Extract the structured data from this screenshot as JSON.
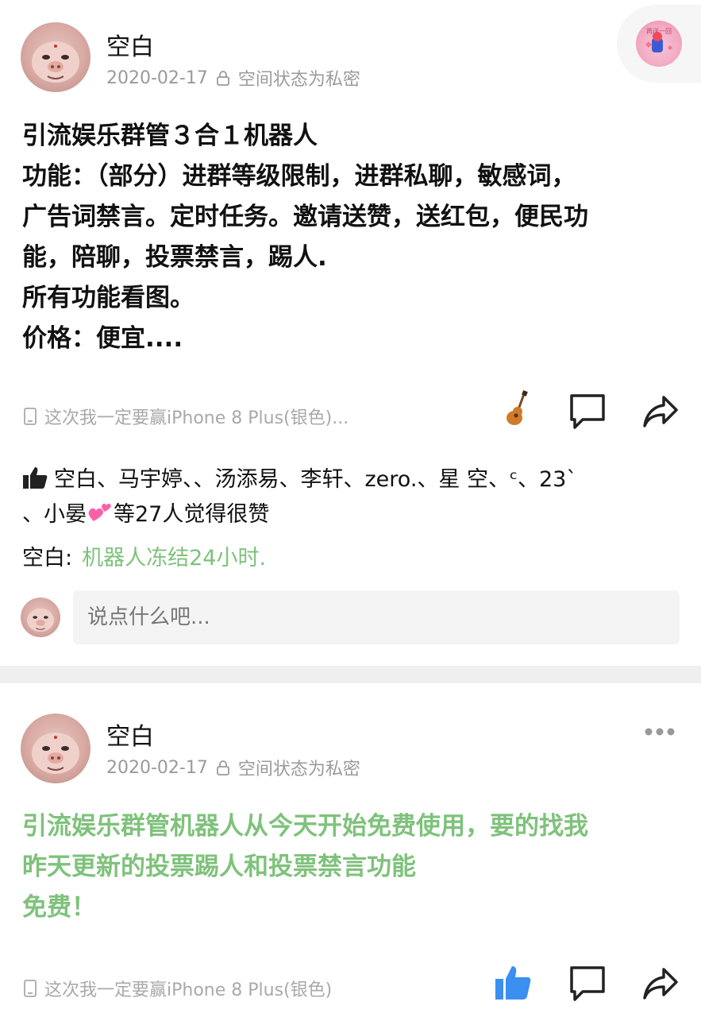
{
  "posts": [
    {
      "author": "空白",
      "date": "2020-02-17",
      "privacy": "空间状态为私密",
      "content_lines": [
        "引流娱乐群管３合１机器人",
        "功能：（部分）进群等级限制，进群私聊，敏感词，",
        "广告词禁言。定时任务。邀请送赞，送红包，便民功",
        "能，陪聊，投票禁言，踢人.",
        "所有功能看图。",
        "价格：便宜...."
      ],
      "device": "这次我一定要赢iPhone 8 Plus(银色)...",
      "likes_line1": "空白、马宇婷、、汤添易、李轩、zero.、星 空、ᶜ、23`",
      "likes_line2_prefix": "、小晏",
      "likes_line2_suffix": "等27人觉得很赞",
      "comment_author": "空白:",
      "comment_text": "机器人冻结24小时.",
      "comment_placeholder": "说点什么吧..."
    },
    {
      "author": "空白",
      "date": "2020-02-17",
      "privacy": "空间状态为私密",
      "content_lines": [
        "引流娱乐群管机器人从今天开始免费使用，要的找我",
        "昨天更新的投票踢人和投票禁言功能",
        "免费！"
      ],
      "device": "这次我一定要赢iPhone 8 Plus(银色)"
    }
  ],
  "badge_text": "再送一回",
  "colors": {
    "green_text": "#7ec27b",
    "meta_gray": "#9a9a9a",
    "like_blue": "#3a8ff0"
  },
  "icons": [
    "lock-icon",
    "phone-icon",
    "guitar-icon",
    "comment-icon",
    "share-icon",
    "thumb-up-icon",
    "heart-emoji-icon",
    "more-icon"
  ]
}
